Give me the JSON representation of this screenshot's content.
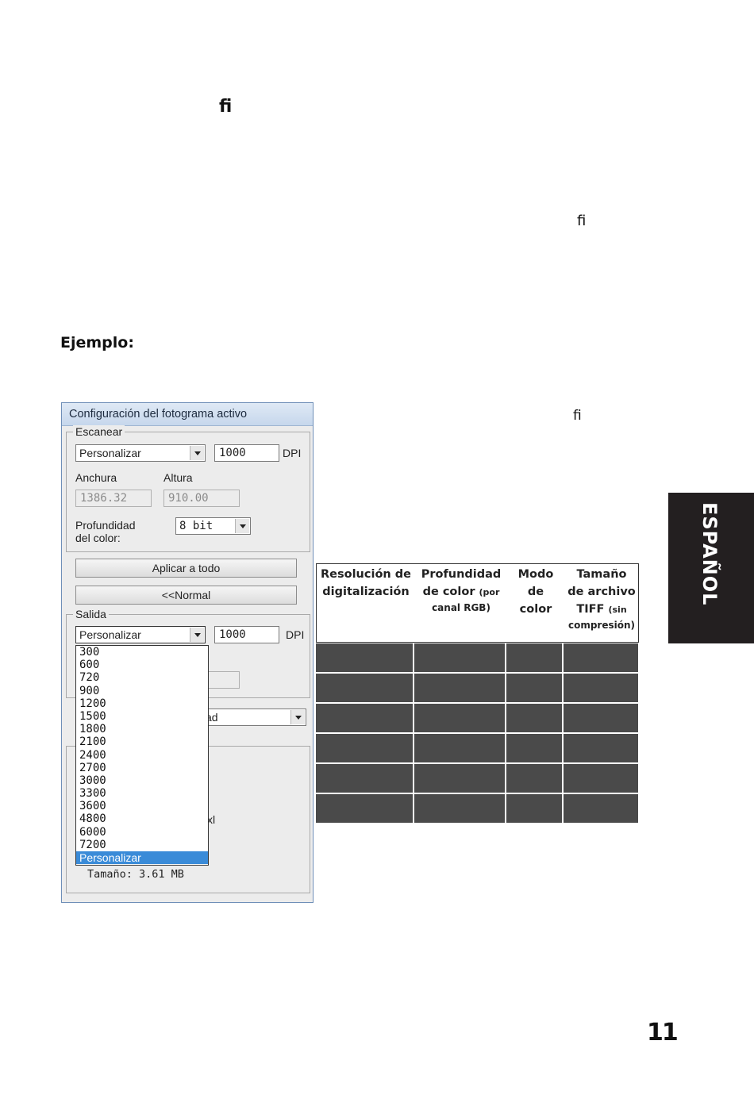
{
  "page": {
    "ligature_glyph": "ﬁ",
    "heading": "Ejemplo:",
    "side_tab": "ESPAÑOL",
    "page_number": "11"
  },
  "dialog": {
    "title": "Configuración del fotograma activo",
    "scan": {
      "legend": "Escanear",
      "preset": "Personalizar",
      "dpi_value": "1000",
      "dpi_unit": "DPI",
      "width_label": "Anchura",
      "height_label": "Altura",
      "width_value": "1386.32",
      "height_value": "910.00",
      "depth_label_1": "Profundidad",
      "depth_label_2": "del color:",
      "depth_value": "8 bit"
    },
    "apply_all_button": "Aplicar a todo",
    "normal_button": "<<Normal",
    "output": {
      "legend": "Salida",
      "preset": "Personalizar",
      "dpi_value": "1000",
      "dpi_unit": "DPI"
    },
    "partial_combo_text": "ad",
    "partial_text": "xl",
    "size_text": "Tamaño: 3.61 MB",
    "dropdown_options": [
      "300",
      "600",
      "720",
      "900",
      "1200",
      "1500",
      "1800",
      "2100",
      "2400",
      "2700",
      "3000",
      "3300",
      "3600",
      "4800",
      "6000",
      "7200",
      "Personalizar"
    ],
    "dropdown_selected": "Personalizar"
  },
  "table": {
    "headers": [
      {
        "line1": "Resolución de",
        "line2": "digitalización",
        "line3": "",
        "small": ""
      },
      {
        "line1": "Profundidad",
        "line2": "de color",
        "small2": "(por",
        "line3": "canal RGB)"
      },
      {
        "line1": "Modo",
        "line2": "de",
        "line3": "color"
      },
      {
        "line1": "Tamaño",
        "line2": "de archivo",
        "line3": "TIFF",
        "small3": "(sin",
        "line4": "compresión)"
      }
    ],
    "rows": 6
  }
}
